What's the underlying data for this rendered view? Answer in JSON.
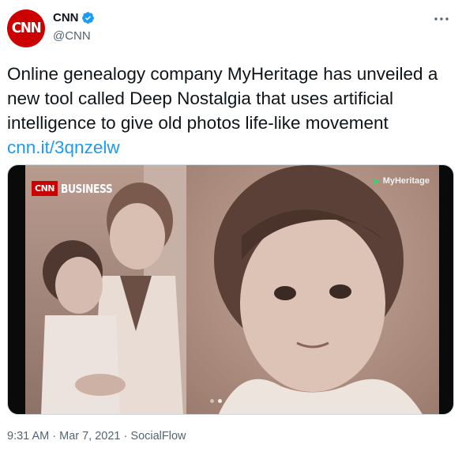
{
  "author": {
    "avatar_text": "CNN",
    "name": "CNN",
    "handle": "@CNN",
    "verified_icon": "verified-badge-icon"
  },
  "tweet": {
    "text": "Online genealogy company MyHeritage has unveiled a new tool called Deep Nostalgia that uses artificial intelligence to give old photos life-like movement",
    "link": "cnn.it/3qnzelw"
  },
  "media": {
    "badge_brand": "CNN",
    "badge_section": "BUSINESS",
    "watermark": "MyHeritage"
  },
  "meta": {
    "time": "9:31 AM",
    "separator1": "·",
    "date": "Mar 7, 2021",
    "separator2": "·",
    "source": "SocialFlow"
  },
  "colors": {
    "brand_red": "#cc0000",
    "link_blue": "#1d9bf0",
    "verified_blue": "#1d9bf0",
    "secondary_text": "#536471"
  },
  "icons": [
    "more-options-icon",
    "verified-badge-icon",
    "play-arrow-icon"
  ]
}
